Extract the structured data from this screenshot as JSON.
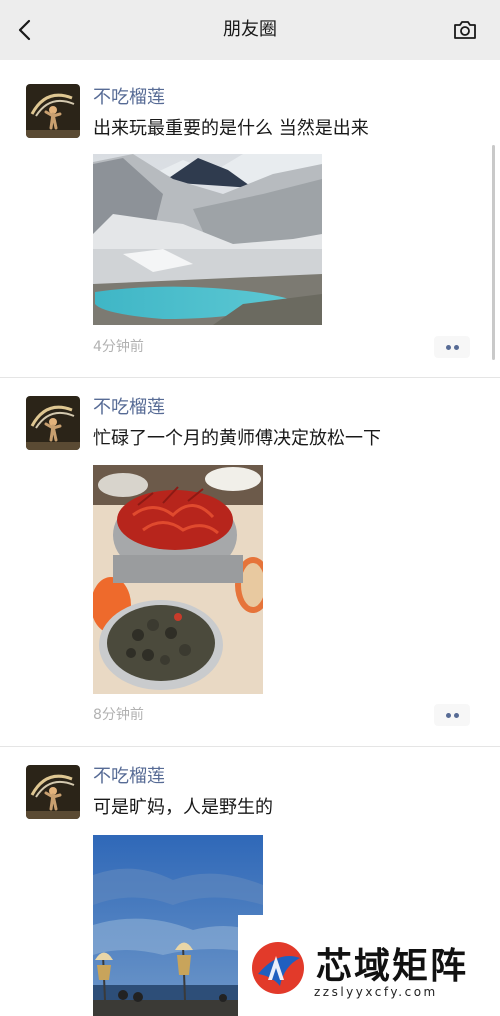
{
  "nav": {
    "title": "朋友圈",
    "back_icon": "chevron-left-icon",
    "camera_icon": "camera-icon"
  },
  "posts": [
    {
      "username": "不吃榴莲",
      "text": "出来玩最重要的是什么  当然是出来",
      "time": "4分钟前",
      "image": "mountain-lake-photo"
    },
    {
      "username": "不吃榴莲",
      "text": "忙碌了一个月的黄师傅决定放松一下",
      "time": "8分钟前",
      "image": "crayfish-dinner-photo"
    },
    {
      "username": "不吃榴莲",
      "text": "可是旷妈，人是野生的",
      "image": "seaside-sky-photo"
    }
  ],
  "watermark": {
    "title": "芯域矩阵",
    "url": "zzslyyxcfy.com"
  },
  "colors": {
    "nav_background": "#ededed",
    "username": "#576b95",
    "timestamp": "#b2b2b2"
  }
}
